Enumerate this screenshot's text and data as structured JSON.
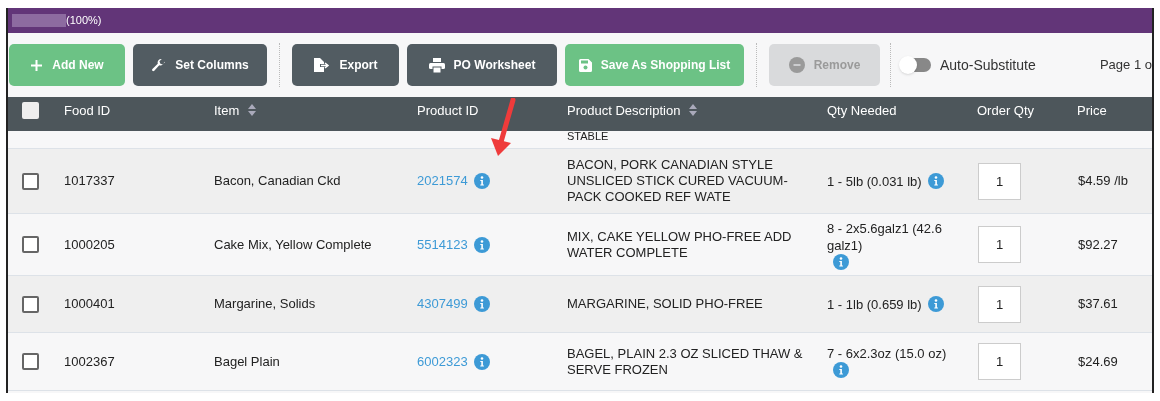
{
  "progress": {
    "label": "(100%)",
    "level": 1
  },
  "toolbar": [
    {
      "label": "Add New",
      "kind": "add",
      "disabled": false
    },
    {
      "label": "Set Columns",
      "kind": "wrench",
      "disabled": false
    },
    {
      "label": "Export",
      "kind": "export",
      "disabled": false
    },
    {
      "label": "PO Worksheet",
      "kind": "print",
      "disabled": false
    },
    {
      "label": "Save As Shopping List",
      "kind": "save",
      "disabled": false
    },
    {
      "label": "Remove",
      "kind": "remove",
      "disabled": true
    }
  ],
  "auto_substitute": {
    "label": "Auto-Substitute",
    "on": false
  },
  "pager": "Page 1 o",
  "table": {
    "select_all": {
      "checked": false
    },
    "columns": [
      {
        "label": "Food ID",
        "sortable": false
      },
      {
        "label": "Item",
        "sortable": true
      },
      {
        "label": "Product ID",
        "sortable": false
      },
      {
        "label": "Product Description",
        "sortable": true
      },
      {
        "label": "Qty Needed",
        "sortable": false
      },
      {
        "label": "Order Qty",
        "sortable": false
      },
      {
        "label": "Price",
        "sortable": false
      }
    ],
    "partial_row_text": "STABLE",
    "rows": [
      {
        "checked": false,
        "food_id": "1017337",
        "item": "Bacon, Canadian Ckd",
        "product_id": "2021574",
        "description": "BACON, PORK CANADIAN STYLE UNSLICED STICK CURED VACUUM-PACK COOKED REF WATE",
        "qty_needed": "1 - 5lb (0.031 lb)",
        "order_qty": "1",
        "price": "$4.59 /lb"
      },
      {
        "checked": false,
        "food_id": "1000205",
        "item": "Cake Mix, Yellow Complete",
        "product_id": "5514123",
        "description": "MIX, CAKE YELLOW PHO-FREE ADD WATER COMPLETE",
        "qty_needed": "8 - 2x5.6galz1 (42.6 galz1)",
        "order_qty": "1",
        "price": "$92.27"
      },
      {
        "checked": false,
        "food_id": "1000401",
        "item": "Margarine, Solids",
        "product_id": "4307499",
        "description": "MARGARINE, SOLID PHO-FREE",
        "qty_needed": "1 - 1lb (0.659 lb)",
        "order_qty": "1",
        "price": "$37.61"
      },
      {
        "checked": false,
        "food_id": "1002367",
        "item": "Bagel Plain",
        "product_id": "6002323",
        "description": "BAGEL, PLAIN 2.3 OZ SLICED THAW & SERVE FROZEN",
        "qty_needed": "7 - 6x2.3oz (15.0 oz)",
        "order_qty": "1",
        "price": "$24.69"
      }
    ]
  }
}
